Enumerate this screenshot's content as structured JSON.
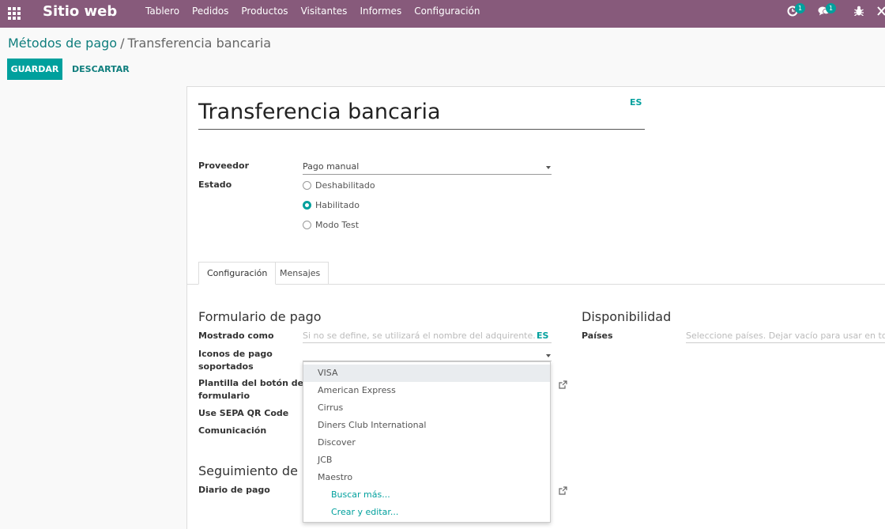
{
  "app": {
    "brand": "Sitio web"
  },
  "nav": {
    "items": [
      "Tablero",
      "Pedidos",
      "Productos",
      "Visitantes",
      "Informes",
      "Configuración"
    ]
  },
  "systray": {
    "activity_count": "1",
    "messages_count": "1"
  },
  "breadcrumb": {
    "parent": "Métodos de pago",
    "separator": "/",
    "current": "Transferencia bancaria"
  },
  "actions": {
    "save": "GUARDAR",
    "discard": "DESCARTAR"
  },
  "form": {
    "name": "Transferencia bancaria",
    "lang": "ES",
    "provider_label": "Proveedor",
    "provider_value": "Pago manual",
    "state_label": "Estado",
    "state_options": [
      "Deshabilitado",
      "Habilitado",
      "Modo Test"
    ],
    "state_selected": "Habilitado"
  },
  "tabs": {
    "config": "Configuración",
    "messages": "Mensajes"
  },
  "payment_form": {
    "title": "Formulario de pago",
    "display_as_label": "Mostrado como",
    "display_as_placeholder": "Si no se define, se utilizará el nombre del adquirente.",
    "display_as_lang": "ES",
    "icons_label_line1": "Iconos de pago",
    "icons_label_line2": "soportados",
    "button_template_label_line1": "Plantilla del botón del",
    "button_template_label_line2": "formulario",
    "sepa_label": "Use SEPA QR Code",
    "communication_label": "Comunicación"
  },
  "followup": {
    "title": "Seguimiento de P",
    "journal_label": "Diario de pago"
  },
  "availability": {
    "title": "Disponibilidad",
    "countries_label": "Países",
    "countries_placeholder": "Seleccione países. Dejar vacío para usar en todas"
  },
  "dropdown": {
    "items": [
      "VISA",
      "American Express",
      "Cirrus",
      "Diners Club International",
      "Discover",
      "JCB",
      "Maestro"
    ],
    "search_more": "Buscar más...",
    "create_edit": "Crear y editar..."
  },
  "colors": {
    "navbar": "#875a7b",
    "primary": "#00a09d",
    "link": "#0f7e7d"
  }
}
